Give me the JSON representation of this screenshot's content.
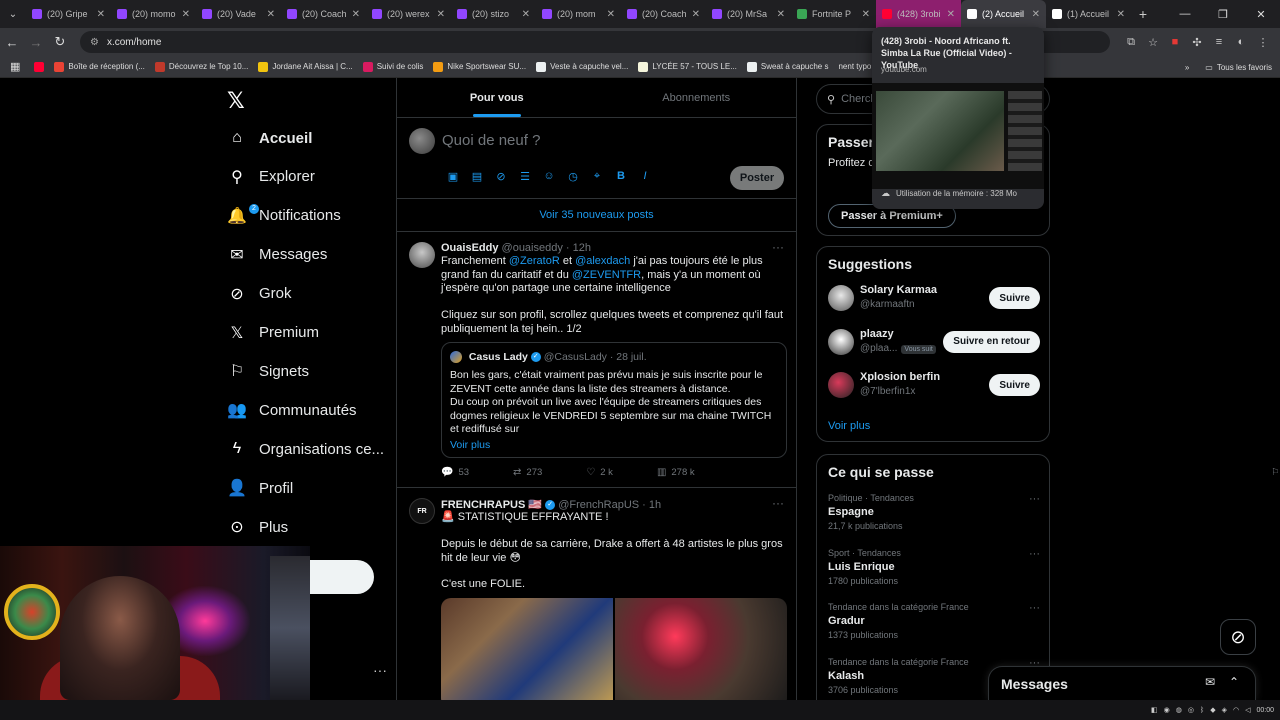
{
  "browser": {
    "tabs": [
      {
        "label": "(20) Gripe",
        "color": "#9146ff"
      },
      {
        "label": "(20) momo",
        "color": "#9146ff"
      },
      {
        "label": "(20) Vade",
        "color": "#9146ff"
      },
      {
        "label": "(20) Coach",
        "color": "#9146ff"
      },
      {
        "label": "(20) werex",
        "color": "#9146ff"
      },
      {
        "label": "(20) stizo",
        "color": "#9146ff"
      },
      {
        "label": "(20) mom",
        "color": "#9146ff"
      },
      {
        "label": "(20) Coach",
        "color": "#9146ff"
      },
      {
        "label": "(20) MrSa",
        "color": "#9146ff"
      },
      {
        "label": "Fortnite P",
        "color": "#3aa655"
      },
      {
        "label": "(428) 3robi",
        "color": "#ff0033"
      },
      {
        "label": "(2) Accueil",
        "color": "#ffffff"
      },
      {
        "label": "(1) Accueil",
        "color": "#ffffff"
      }
    ],
    "url": "x.com/home",
    "bookmarks": [
      {
        "label": "Boîte de réception (...",
        "color": "#ea4335"
      },
      {
        "label": "Découvrez le Top 10...",
        "color": "#c0392b"
      },
      {
        "label": "Jordane Ait Aissa | C...",
        "color": "#f1c40f"
      },
      {
        "label": "Suivi de colis",
        "color": "#d81b60"
      },
      {
        "label": "Nike Sportswear SU...",
        "color": "#f39c12"
      },
      {
        "label": "Veste à capuche vel...",
        "color": "#ecf0f1"
      },
      {
        "label": "LYCÉE 57 - TOUS LE...",
        "color": "#f5f5dc"
      },
      {
        "label": "Sweat à capuche s",
        "color": "#ecf0f1"
      }
    ],
    "bookmark_extra": "nent typo flu...",
    "bookmark_all": "Tous les favoris",
    "hover_card": {
      "title": "(428) 3robi - Noord Africano ft. Simba La Rue (Official Video) - YouTube",
      "domain": "youtube.com",
      "memory": "Utilisation de la mémoire : 328 Mo"
    }
  },
  "nav": {
    "items": [
      {
        "label": "Accueil",
        "icon": "home-icon",
        "glyph": "⌂",
        "active": true
      },
      {
        "label": "Explorer",
        "icon": "search-icon",
        "glyph": "⚲"
      },
      {
        "label": "Notifications",
        "icon": "bell-icon",
        "glyph": "🔔",
        "badge": "2"
      },
      {
        "label": "Messages",
        "icon": "envelope-icon",
        "glyph": "✉"
      },
      {
        "label": "Grok",
        "icon": "grok-icon",
        "glyph": "⊘"
      },
      {
        "label": "Premium",
        "icon": "x-premium-icon",
        "glyph": "𝕏"
      },
      {
        "label": "Signets",
        "icon": "bookmark-icon",
        "glyph": "⚐"
      },
      {
        "label": "Communautés",
        "icon": "communities-icon",
        "glyph": "👥"
      },
      {
        "label": "Organisations ce...",
        "icon": "lightning-icon",
        "glyph": "ϟ"
      },
      {
        "label": "Profil",
        "icon": "profile-icon",
        "glyph": "👤"
      },
      {
        "label": "Plus",
        "icon": "more-circle-icon",
        "glyph": "⊙"
      }
    ],
    "account_more": "···"
  },
  "timeline": {
    "tabs": [
      "Pour vous",
      "Abonnements"
    ],
    "composer_placeholder": "Quoi de neuf ?",
    "post_button": "Poster",
    "new_posts": "Voir 35 nouveaux posts",
    "tweets": [
      {
        "name": "OuaisEddy",
        "handle": "@ouaiseddy",
        "time": "· 12h",
        "body": [
          {
            "t": "Franchement "
          },
          {
            "m": "@ZeratoR"
          },
          {
            "t": " et "
          },
          {
            "m": "@alexdach"
          },
          {
            "t": " j'ai pas toujours été le plus grand fan du caritatif et du "
          },
          {
            "m": "@ZEVENTFR"
          },
          {
            "t": ", mais y'a un moment où j'espère qu'on partage une certaine intelligence"
          }
        ],
        "body2": "Cliquez sur son profil, scrollez quelques tweets et comprenez qu'il faut publiquement la tej hein.. 1/2",
        "quote": {
          "name": "Casus Lady",
          "handle": "@CasusLady",
          "time": "· 28 juil.",
          "body": "Bon les gars, c'était vraiment pas prévu mais je suis inscrite pour le ZEVENT cette année dans la liste des streamers à distance.\nDu coup on prévoit un live avec l'équipe de streamers critiques des dogmes religieux le VENDREDI 5 septembre sur ma chaine TWITCH et rediffusé sur",
          "more": "Voir plus"
        },
        "stats": {
          "replies": "53",
          "reposts": "273",
          "likes": "2 k",
          "views": "278 k"
        }
      },
      {
        "name": "FRENCHRAPUS",
        "flag": "🇺🇸",
        "handle": "@FrenchRapUS",
        "time": "· 1h",
        "line1": "🚨 STATISTIQUE EFFRAYANTE !",
        "line2": "Depuis le début de sa carrière, Drake a offert à 48 artistes le plus gros hit de leur vie 😳",
        "line3": "C'est une FOLIE."
      }
    ]
  },
  "sidebar": {
    "search_placeholder": "Cherch",
    "premium": {
      "title": "Passer",
      "text": "Profitez d l'absence des répo",
      "button": "Passer à Premium+"
    },
    "suggestions": {
      "title": "Suggestions",
      "items": [
        {
          "name": "Solary Karmaa",
          "handle": "@karmaaftn",
          "button": "Suivre",
          "badge": ""
        },
        {
          "name": "plaazy",
          "handle": "@plaa...",
          "button": "Suivre en retour",
          "badge": "Vous suit"
        },
        {
          "name": "Xplosion berfin",
          "handle": "@7'lberfin1x",
          "button": "Suivre",
          "badge": ""
        }
      ],
      "more": "Voir plus"
    },
    "trends": {
      "title": "Ce qui se passe",
      "items": [
        {
          "category": "Politique · Tendances",
          "name": "Espagne",
          "count": "21,7 k publications"
        },
        {
          "category": "Sport · Tendances",
          "name": "Luis Enrique",
          "count": "1780 publications"
        },
        {
          "category": "Tendance dans la catégorie France",
          "name": "Gradur",
          "count": "1373 publications"
        },
        {
          "category": "Tendance dans la catégorie France",
          "name": "Kalash",
          "count": "3706 publications"
        }
      ]
    }
  },
  "messages_dock": {
    "title": "Messages"
  },
  "taskbar": {
    "clock": "00:00"
  }
}
